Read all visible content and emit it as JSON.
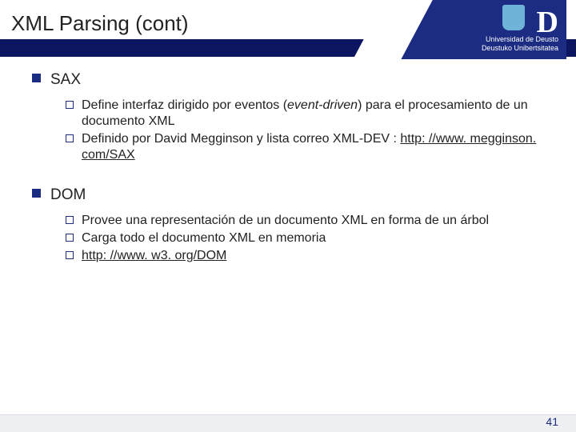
{
  "header": {
    "title": "XML Parsing (cont)",
    "logo": {
      "letter": "D",
      "line1": "Universidad de Deusto",
      "line2": "Deustuko Unibertsitatea"
    }
  },
  "content": {
    "items": [
      {
        "label": "SAX",
        "subs": [
          {
            "pre": "Define interfaz dirigido por eventos (",
            "em": "event-driven",
            "post": ") para el procesamiento de un documento XML"
          },
          {
            "pre": "Definido por David Megginson y lista correo XML-DEV : ",
            "link": "http: //www. megginson. com/SAX"
          }
        ]
      },
      {
        "label": "DOM",
        "subs": [
          {
            "pre": "Provee una representación de un documento XML en forma de un árbol"
          },
          {
            "pre": "Carga todo el documento XML en memoria"
          },
          {
            "link": "http: //www. w3. org/DOM"
          }
        ]
      }
    ]
  },
  "footer": {
    "page": "41"
  }
}
